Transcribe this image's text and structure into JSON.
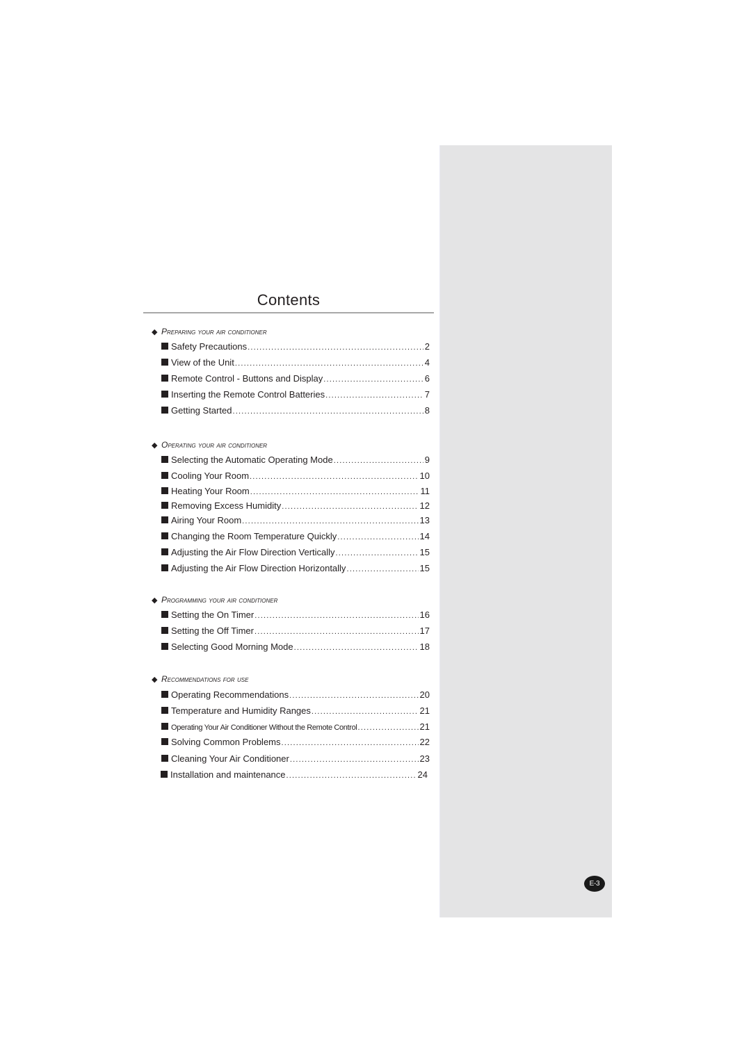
{
  "title": "Contents",
  "page_badge": "E-3",
  "icons": {
    "section_marker": "diamond-icon",
    "entry_marker": "square-bullet-icon"
  },
  "sections": [
    {
      "heading": "Preparing your air conditioner",
      "entries": [
        {
          "label": "Safety Precautions",
          "page": "2"
        },
        {
          "label": "View of the Unit",
          "page": "4"
        },
        {
          "label": "Remote Control - Buttons and Display",
          "page": "6"
        },
        {
          "label": "Inserting the Remote Control Batteries",
          "page": "7"
        },
        {
          "label": "Getting Started",
          "page": "8"
        }
      ]
    },
    {
      "heading": "Operating your air conditioner",
      "entries": [
        {
          "label": "Selecting the Automatic Operating Mode",
          "page": "9"
        },
        {
          "label": "Cooling Your Room",
          "page": "10"
        },
        {
          "label": "Heating Your Room",
          "page": "11"
        },
        {
          "label": "Removing Excess Humidity",
          "page": "12"
        },
        {
          "label": "Airing Your Room",
          "page": "13"
        },
        {
          "label": "Changing the Room Temperature Quickly",
          "page": "14"
        },
        {
          "label": "Adjusting the Air Flow Direction Vertically",
          "page": "15"
        },
        {
          "label": "Adjusting the Air Flow Direction Horizontally",
          "page": "15"
        }
      ]
    },
    {
      "heading": "Programming your air conditioner",
      "entries": [
        {
          "label": "Setting the On Timer",
          "page": "16"
        },
        {
          "label": "Setting the Off Timer",
          "page": "17"
        },
        {
          "label": "Selecting Good Morning Mode",
          "page": "18"
        }
      ]
    },
    {
      "heading": "Recommendations for use",
      "entries": [
        {
          "label": "Operating Recommendations",
          "page": "20"
        },
        {
          "label": "Temperature and Humidity Ranges",
          "page": "21"
        },
        {
          "label": "Operating Your Air Conditioner Without the Remote Control",
          "page": "21"
        },
        {
          "label": "Solving Common Problems",
          "page": "22"
        },
        {
          "label": "Cleaning Your Air Conditioner",
          "page": "23"
        },
        {
          "label": "Installation and maintenance",
          "page": "24"
        }
      ]
    }
  ]
}
